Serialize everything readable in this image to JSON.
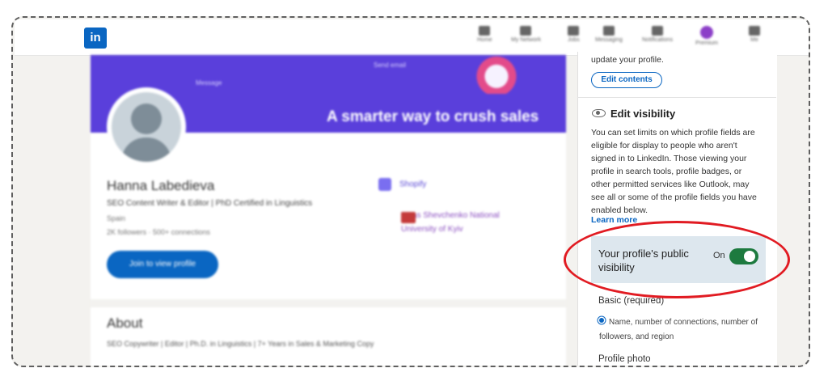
{
  "nav": {
    "logo": "in",
    "items": [
      "Home",
      "My Network",
      "Jobs",
      "Messaging",
      "Notifications",
      "Premium",
      "Me"
    ]
  },
  "profile": {
    "banner_text": "A smarter way to crush sales",
    "banner_msg": "Message",
    "banner_send": "Send email",
    "name": "Hanna Labedieva",
    "headline": "SEO Content Writer & Editor | PhD Certified in Linguistics",
    "location": "Spain",
    "stats": "2K followers  ·  500+ connections",
    "join_button": "Join to view profile",
    "company": "Shopify",
    "university": "Taras Shevchenko National University of Kyiv",
    "about_heading": "About",
    "about_text": "SEO Copywriter | Editor | Ph.D. in Linguistics | 7+ Years in Sales & Marketing Copy"
  },
  "panel": {
    "top_text": "update your profile.",
    "edit_contents": "Edit contents",
    "edit_visibility_title": "Edit visibility",
    "edit_visibility_desc": "You can set limits on which profile fields are eligible for display to people who aren't signed in to LinkedIn. Those viewing your profile in search tools, profile badges, or other permitted services like Outlook, may see all or some of the profile fields you have enabled below.",
    "learn_more": "Learn more",
    "public_visibility_label": "Your profile's public visibility",
    "toggle_state": "On",
    "basic_label": "Basic (required)",
    "basic_desc": "Name, number of connections, number of followers, and region",
    "profile_photo": "Profile photo"
  },
  "colors": {
    "accent": "#0a66c2",
    "toggle_on": "#1d7a3f",
    "annotation": "#e11b22",
    "banner": "#5a3fdb"
  }
}
